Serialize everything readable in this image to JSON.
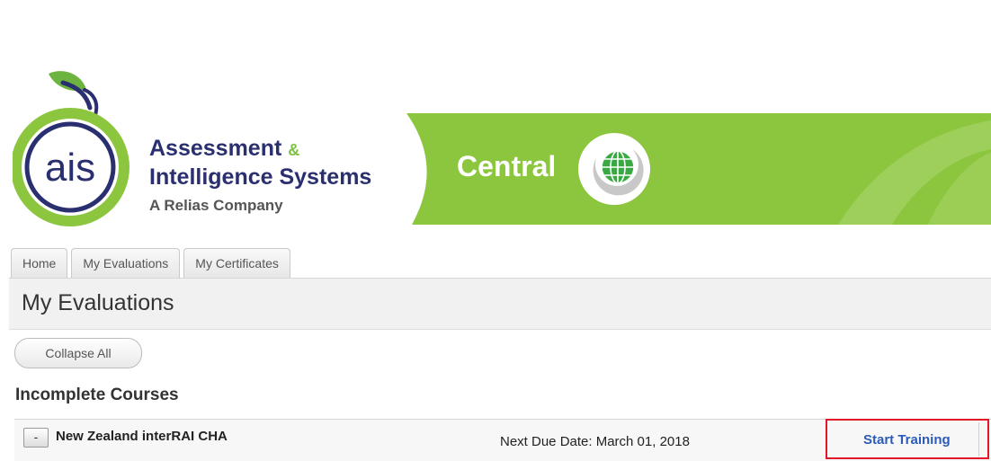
{
  "header": {
    "brand_line1": "Assessment",
    "brand_amp": "&",
    "brand_line2": "Intelligence Systems",
    "brand_line3": "A Relias Company",
    "logo_text": "ais",
    "banner_title": "Central"
  },
  "tabs": [
    {
      "label": "Home"
    },
    {
      "label": "My Evaluations"
    },
    {
      "label": "My Certificates"
    }
  ],
  "page": {
    "title": "My Evaluations",
    "collapse_label": "Collapse All",
    "section_heading": "Incomplete Courses"
  },
  "courses": [
    {
      "toggle": "-",
      "name": "New Zealand interRAI CHA",
      "due": "Next Due Date: March 01, 2018",
      "action": "Start Training"
    }
  ],
  "colors": {
    "brand_navy": "#2a2f70",
    "brand_green": "#7cc242",
    "link_blue": "#2b5bb8",
    "highlight_red": "#e2182a"
  },
  "icons": {
    "logo": "ais-apple-logo-icon",
    "globe": "globe-icon"
  }
}
